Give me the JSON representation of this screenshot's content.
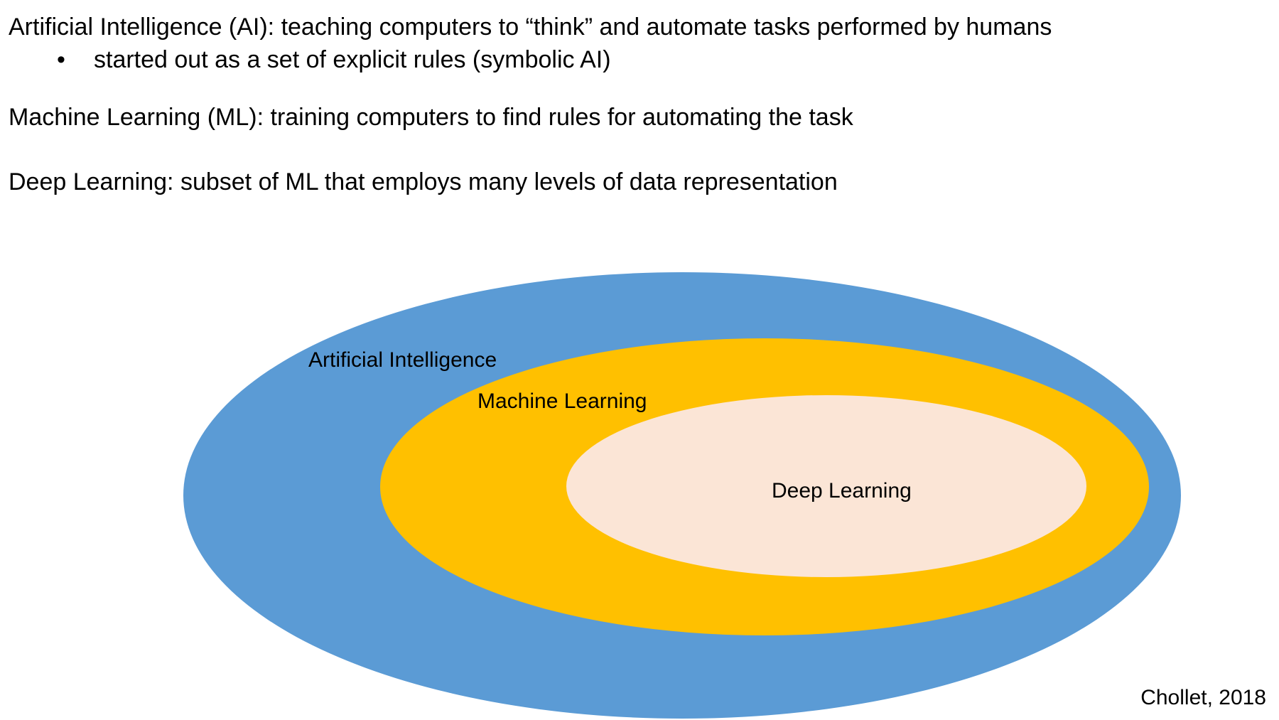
{
  "text": {
    "ai_line": "Artificial Intelligence (AI): teaching computers to “think” and automate tasks performed by humans",
    "bullet_marker": "•",
    "bullet_text": "started out as a set of explicit rules (symbolic AI)",
    "ml_line": "Machine Learning (ML): training computers to find rules for automating the task",
    "dl_line": "Deep Learning: subset of ML that employs many levels of data representation"
  },
  "diagram": {
    "outer_label": "Artificial Intelligence",
    "middle_label": "Machine Learning",
    "inner_label": "Deep Learning",
    "colors": {
      "outer": "#5B9BD5",
      "middle": "#FFC000",
      "inner": "#FBE5D6"
    }
  },
  "citation": "Chollet, 2018"
}
